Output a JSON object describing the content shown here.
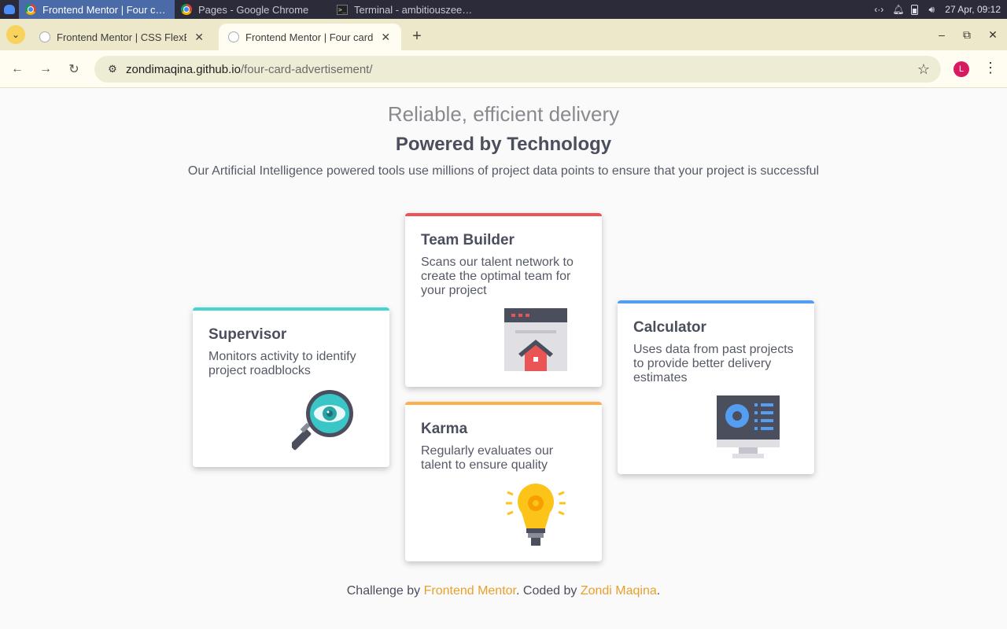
{
  "taskbar": {
    "tasks": [
      {
        "label": "Frontend Mentor | Four car...",
        "active": true,
        "icon": "chrome-icon"
      },
      {
        "label": "Pages - Google Chrome",
        "active": false,
        "icon": "chrome-icon"
      },
      {
        "label": "Terminal - ambitiouszee@X...",
        "active": false,
        "icon": "terminal-icon"
      }
    ],
    "clock": "27 Apr, 09:12"
  },
  "browser": {
    "tabs": [
      {
        "title": "Frontend Mentor | CSS FlexBo",
        "active": false
      },
      {
        "title": "Frontend Mentor | Four card f",
        "active": true
      }
    ],
    "url_host": "zondimaqina.github.io",
    "url_path": "/four-card-advertisement/",
    "profile_initial": "L"
  },
  "page": {
    "heading_light": "Reliable, efficient delivery",
    "heading_bold": "Powered by Technology",
    "intro": "Our Artificial Intelligence powered tools use millions of project data points to ensure that your project is successful",
    "cards": {
      "supervisor": {
        "title": "Supervisor",
        "text": "Monitors activity to identify project roadblocks",
        "accent": "#45d3d3"
      },
      "team_builder": {
        "title": "Team Builder",
        "text": "Scans our talent network to create the optimal team for your project",
        "accent": "#ea5454"
      },
      "karma": {
        "title": "Karma",
        "text": "Regularly evaluates our talent to ensure quality",
        "accent": "#fcaf4a"
      },
      "calculator": {
        "title": "Calculator",
        "text": "Uses data from past projects to provide better delivery estimates",
        "accent": "#549ef2"
      }
    },
    "attribution": {
      "prefix": "Challenge by ",
      "link1": "Frontend Mentor",
      "middle": ". Coded by ",
      "link2": "Zondi Maqina",
      "suffix": "."
    }
  }
}
